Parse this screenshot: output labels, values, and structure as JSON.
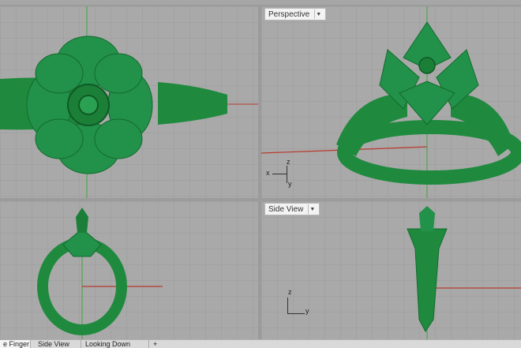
{
  "viewports": {
    "top_left": {
      "label": ""
    },
    "top_right": {
      "label": "Perspective",
      "dropdown_icon": "chevron-down-icon"
    },
    "bottom_left": {
      "label": ""
    },
    "bottom_right": {
      "label": "Side View",
      "dropdown_icon": "chevron-down-icon"
    }
  },
  "axis_labels": {
    "persp_z": "z",
    "persp_x": "x",
    "persp_y": "y",
    "side_z": "z",
    "side_y": "y"
  },
  "tabs": [
    {
      "label": "e Finger",
      "active": true
    },
    {
      "label": "Side View",
      "active": false
    },
    {
      "label": "Looking Down",
      "active": false
    },
    {
      "label": "+",
      "active": false
    }
  ],
  "colors": {
    "model_green": "#1f8a3e",
    "grid_bg": "#a9a9a9",
    "axis_red": "#b83a2e",
    "axis_green": "#3fa33f"
  }
}
